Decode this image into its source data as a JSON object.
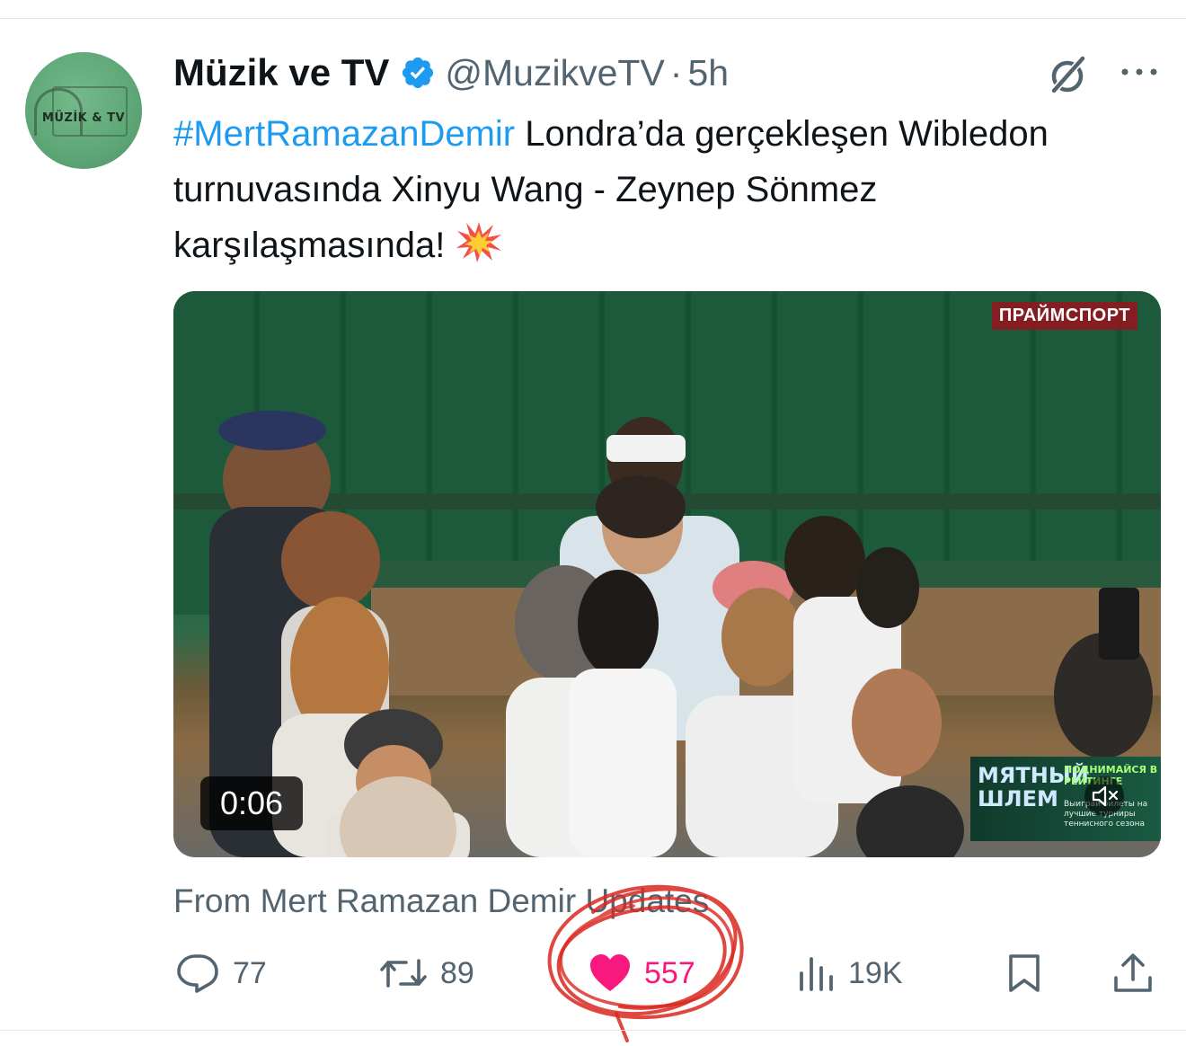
{
  "tweet": {
    "author": {
      "display_name": "Müzik ve TV",
      "handle": "@MuzikveTV",
      "separator": "·",
      "time": "5h",
      "avatar_text": "MÜZİK & TV"
    },
    "text": {
      "hashtag": "#MertRamazanDemir",
      "body": " Londra’da gerçekleşen Wibledon turnuvasında Xinyu Wang - Zeynep Sönmez karşılaşmasında!"
    },
    "media": {
      "broadcaster_logo": "ПРАЙМСПОРТ",
      "duration": "0:06",
      "promo_title": "МЯТНЫЙ ШЛЕМ",
      "promo_heading": "ПОДНИМАЙСЯ В РЕЙТИНГЕ",
      "promo_sub": "Выиграй билеты на лучшие турниры теннисного сезона"
    },
    "source_line": "From Mert Ramazan Demir Updates",
    "stats": {
      "replies": "77",
      "reposts": "89",
      "likes": "557",
      "views": "19K"
    },
    "icons": {
      "verified": "verified-badge-icon",
      "grok": "grok-icon",
      "more": "more-icon",
      "reply": "reply-icon",
      "repost": "repost-icon",
      "like": "heart-icon",
      "views": "views-icon",
      "bookmark": "bookmark-icon",
      "share": "share-icon",
      "mute": "mute-icon"
    },
    "colors": {
      "accent": "#1d9bf0",
      "like": "#f91880",
      "muted": "#536471",
      "annotation": "#d9281f"
    }
  }
}
